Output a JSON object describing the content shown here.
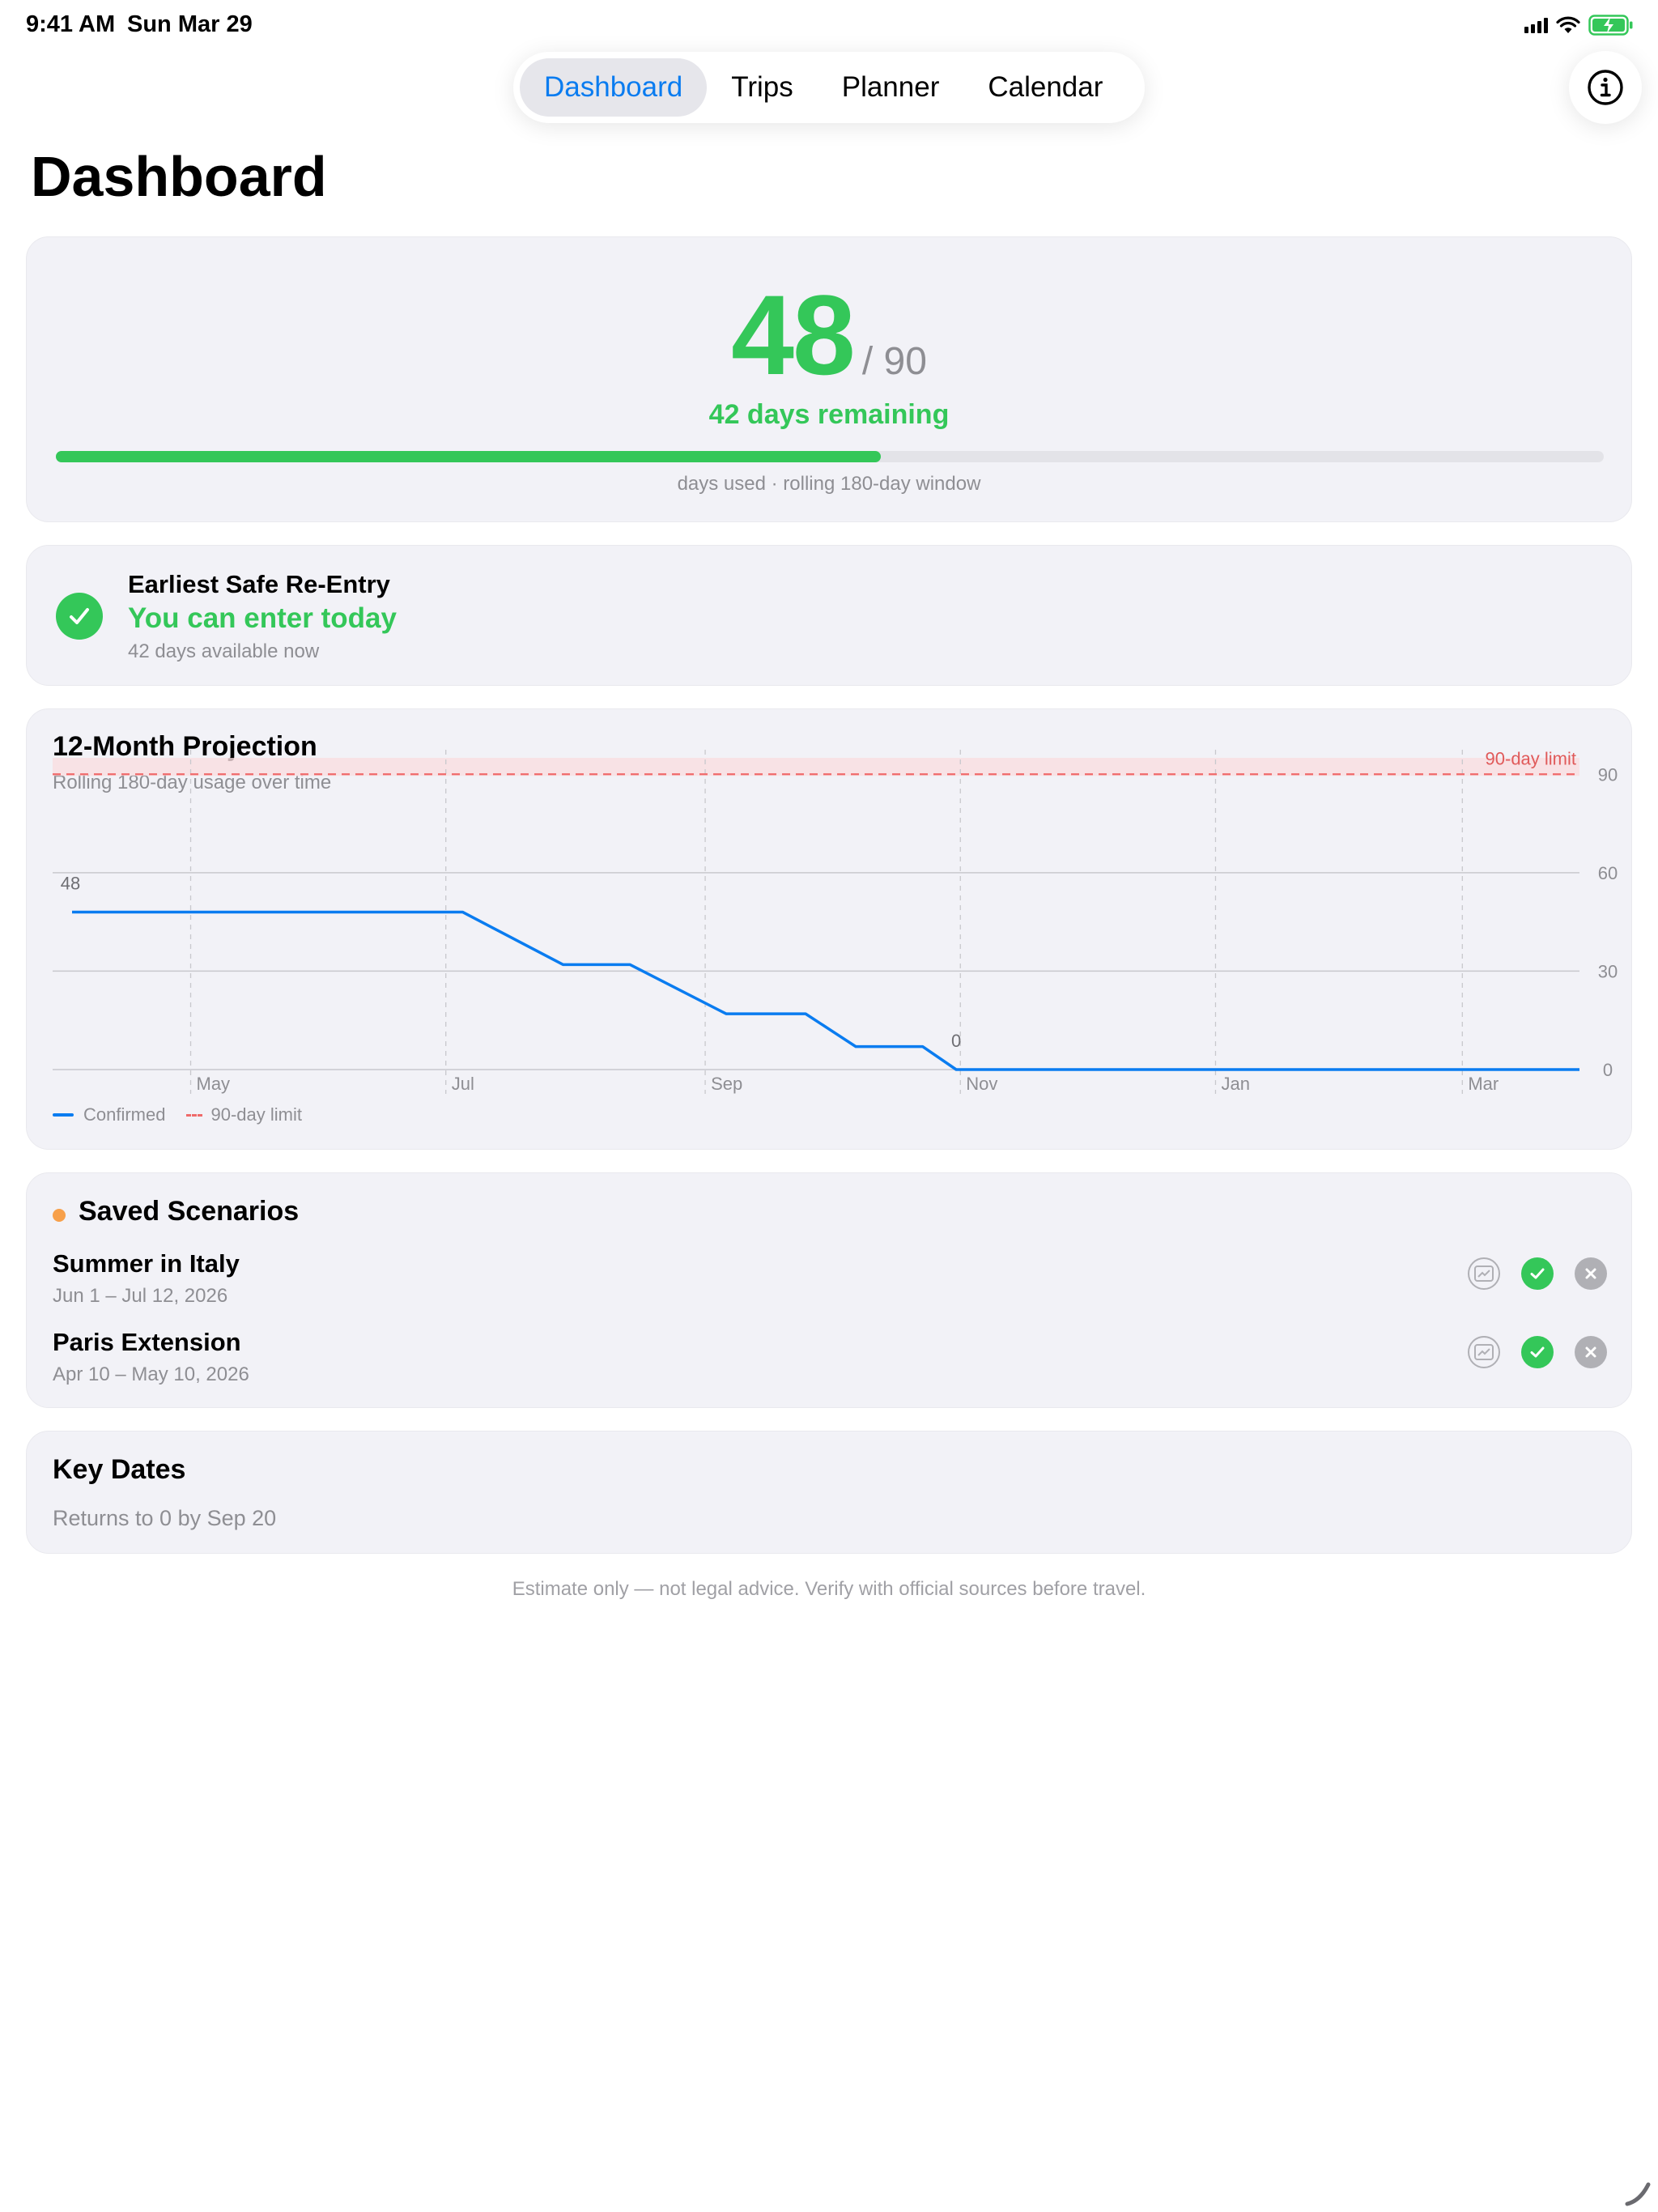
{
  "status_bar": {
    "time": "9:41 AM",
    "date": "Sun Mar 29",
    "icons": [
      "signal-icon",
      "wifi-icon",
      "battery-charging-icon"
    ]
  },
  "tabs": [
    {
      "label": "Dashboard",
      "active": true
    },
    {
      "label": "Trips",
      "active": false
    },
    {
      "label": "Planner",
      "active": false
    },
    {
      "label": "Calendar",
      "active": false
    }
  ],
  "header": {
    "title": "Dashboard",
    "info_icon": "info-icon"
  },
  "usage": {
    "days_used": "48",
    "max_days": "/ 90",
    "remaining_label": "42 days remaining",
    "progress_fraction": 0.533,
    "caption": "days used · rolling 180-day window"
  },
  "reentry": {
    "title": "Earliest Safe Re-Entry",
    "status": "You can enter today",
    "subtitle": "42 days available now"
  },
  "projection": {
    "title": "12-Month Projection",
    "subtitle": "Rolling 180-day usage over time",
    "legend_confirmed": "Confirmed",
    "legend_limit": "90-day limit"
  },
  "chart_data": {
    "type": "line",
    "title": "12-Month Projection",
    "subtitle": "Rolling 180-day usage over time",
    "x_start": "Mar 29",
    "x_end": "Mar 29 (next year)",
    "x_tick_labels": [
      "May",
      "Jul",
      "Sep",
      "Nov",
      "Jan",
      "Mar"
    ],
    "y_ticks": [
      0,
      30,
      60,
      90
    ],
    "ylim": [
      0,
      95
    ],
    "series": [
      {
        "name": "Confirmed",
        "color": "#0a7cf0",
        "points": [
          [
            "Mar 29",
            48
          ],
          [
            "Jul 5",
            48
          ],
          [
            "Jul 29",
            32
          ],
          [
            "Aug 14",
            32
          ],
          [
            "Sep 6",
            17
          ],
          [
            "Sep 25",
            17
          ],
          [
            "Oct 7",
            7
          ],
          [
            "Oct 23",
            7
          ],
          [
            "Oct 31",
            0
          ],
          [
            "Mar 29",
            0
          ]
        ]
      }
    ],
    "limit_line": {
      "value": 90,
      "label": "90-day limit",
      "color": "#ef6a6a"
    },
    "annotations": [
      {
        "label": "48",
        "at": [
          "Mar 29",
          48
        ]
      },
      {
        "label": "0",
        "at": [
          "Oct 31",
          0
        ]
      }
    ],
    "grid": true,
    "legend": [
      "Confirmed",
      "90-day limit"
    ],
    "legend_placement": "bottom-left"
  },
  "scenarios": {
    "title": "Saved Scenarios",
    "dot_color": "#f7a04a",
    "items": [
      {
        "name": "Summer in Italy",
        "dates": "Jun 1 – Jul 12, 2026"
      },
      {
        "name": "Paris Extension",
        "dates": "Apr 10 – May 10, 2026"
      }
    ]
  },
  "key_dates": {
    "title": "Key Dates",
    "line": "Returns to 0 by Sep 20"
  },
  "disclaimer": "Estimate only — not legal advice. Verify with official sources before travel."
}
